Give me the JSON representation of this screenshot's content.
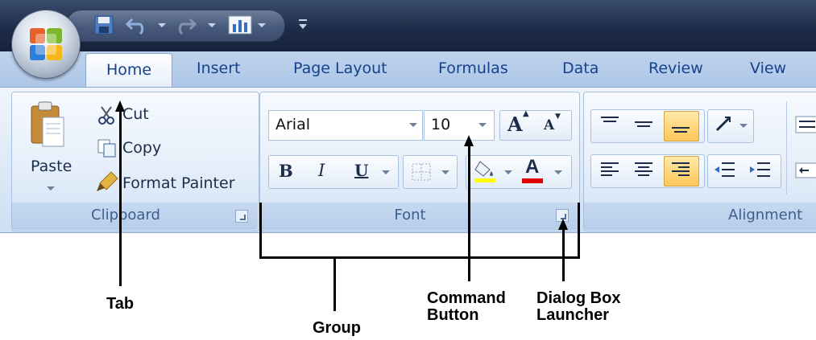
{
  "tabs": [
    "Home",
    "Insert",
    "Page Layout",
    "Formulas",
    "Data",
    "Review",
    "View"
  ],
  "active_tab": "Home",
  "clipboard": {
    "paste_label": "Paste",
    "cut_label": "Cut",
    "copy_label": "Copy",
    "format_painter_label": "Format Painter",
    "group_label": "Clipboard"
  },
  "font": {
    "font_name": "Arial",
    "font_size": "10",
    "bold": "B",
    "italic": "I",
    "underline": "U",
    "grow_glyph": "A",
    "shrink_glyph": "A",
    "color_glyph": "A",
    "group_label": "Font"
  },
  "alignment": {
    "group_label": "Alignment"
  },
  "annotations": {
    "tab": "Tab",
    "group": "Group",
    "command_button": [
      "Command",
      "Button"
    ],
    "dialog_box_launcher": [
      "Dialog Box",
      "Launcher"
    ]
  },
  "colors": {
    "accent_text": "#15428b",
    "highlight_fill": "#ffff00",
    "font_color_bar": "#e00000"
  },
  "icons": [
    "office-logo-icon",
    "save-icon",
    "undo-icon",
    "redo-icon",
    "chart-icon",
    "qat-customize-icon",
    "paste-icon",
    "cut-icon",
    "copy-icon",
    "format-painter-icon",
    "borders-icon",
    "fill-color-icon",
    "font-color-icon",
    "align-top-icon",
    "align-middle-icon",
    "align-bottom-icon",
    "orientation-icon",
    "align-left-icon",
    "align-center-icon",
    "align-right-icon",
    "decrease-indent-icon",
    "increase-indent-icon",
    "wrap-text-icon",
    "merge-center-icon"
  ]
}
